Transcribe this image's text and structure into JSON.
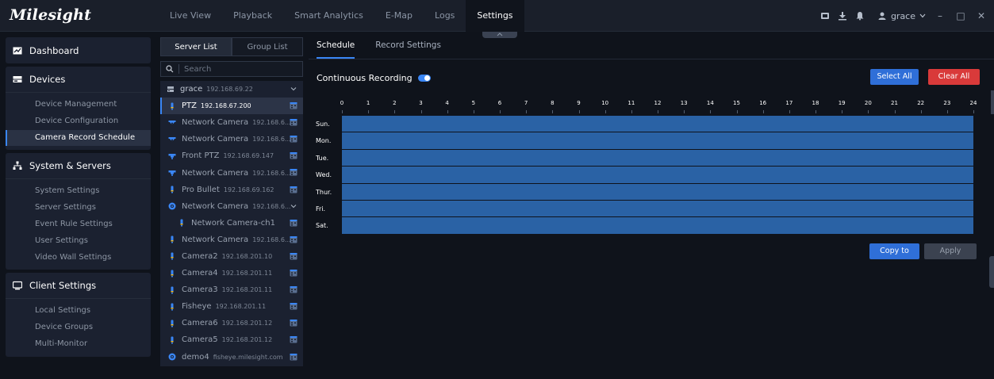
{
  "app": {
    "logo": "Milesight"
  },
  "nav": {
    "items": [
      "Live View",
      "Playback",
      "Smart Analytics",
      "E-Map",
      "Logs",
      "Settings"
    ],
    "active": "Settings"
  },
  "topright": {
    "user": "grace"
  },
  "leftmenu": {
    "dashboard": "Dashboard",
    "devices": {
      "label": "Devices",
      "items": [
        "Device Management",
        "Device Configuration",
        "Camera Record Schedule"
      ],
      "active": "Camera Record Schedule"
    },
    "system": {
      "label": "System & Servers",
      "items": [
        "System Settings",
        "Server Settings",
        "Event Rule Settings",
        "User Settings",
        "Video Wall Settings"
      ]
    },
    "client": {
      "label": "Client Settings",
      "items": [
        "Local Settings",
        "Device Groups",
        "Multi-Monitor"
      ]
    }
  },
  "serverpanel": {
    "tabs": [
      "Server List",
      "Group List"
    ],
    "search_placeholder": "Search",
    "root": {
      "name": "grace",
      "ip": "192.168.69.22"
    },
    "devices": [
      {
        "name": "PTZ",
        "ip": "192.168.67.200",
        "icon": "bullet-camera-icon",
        "selected": true
      },
      {
        "name": "Network Camera",
        "ip": "192.168.6...",
        "icon": "dome-camera-icon"
      },
      {
        "name": "Network Camera",
        "ip": "192.168.6...",
        "icon": "dome-camera-icon"
      },
      {
        "name": "Front PTZ",
        "ip": "192.168.69.147",
        "icon": "ptz-camera-icon"
      },
      {
        "name": "Network Camera",
        "ip": "192.168.6...",
        "icon": "ptz-camera-icon"
      },
      {
        "name": "Pro Bullet",
        "ip": "192.168.69.162",
        "icon": "bullet-camera-icon"
      },
      {
        "name": "Network Camera",
        "ip": "192.168.6...",
        "icon": "nvr-icon",
        "expandable": true
      },
      {
        "name": "Network Camera-ch1",
        "ip": "",
        "icon": "bullet-camera-icon",
        "child": true
      },
      {
        "name": "Network Camera",
        "ip": "192.168.6...",
        "icon": "bullet-camera-icon"
      },
      {
        "name": "Camera2",
        "ip": "192.168.201.10",
        "icon": "bullet-camera-icon"
      },
      {
        "name": "Camera4",
        "ip": "192.168.201.11",
        "icon": "bullet-camera-icon"
      },
      {
        "name": "Camera3",
        "ip": "192.168.201.11",
        "icon": "bullet-camera-icon"
      },
      {
        "name": "Fisheye",
        "ip": "192.168.201.11",
        "icon": "bullet-camera-icon"
      },
      {
        "name": "Camera6",
        "ip": "192.168.201.12",
        "icon": "bullet-camera-icon"
      },
      {
        "name": "Camera5",
        "ip": "192.168.201.12",
        "icon": "bullet-camera-icon"
      },
      {
        "name": "demo4",
        "ip": "fisheye.milesight.com",
        "icon": "nvr-icon"
      }
    ]
  },
  "main": {
    "tabs": [
      "Schedule",
      "Record Settings"
    ],
    "active_tab": "Schedule",
    "continuous_recording_label": "Continuous Recording",
    "continuous_recording_on": true,
    "select_all": "Select All",
    "clear_all": "Clear All",
    "copy_to": "Copy to",
    "apply": "Apply",
    "hours": [
      "0",
      "1",
      "2",
      "3",
      "4",
      "5",
      "6",
      "7",
      "8",
      "9",
      "10",
      "11",
      "12",
      "13",
      "14",
      "15",
      "16",
      "17",
      "18",
      "19",
      "20",
      "21",
      "22",
      "23",
      "24"
    ],
    "days": [
      "Sun.",
      "Mon.",
      "Tue.",
      "Wed.",
      "Thur.",
      "Fri.",
      "Sat."
    ],
    "schedule_fill": "all hours scheduled",
    "colors": {
      "accent": "#3a86f5",
      "schedule": "#2a62a5",
      "danger": "#d93a3a"
    }
  }
}
